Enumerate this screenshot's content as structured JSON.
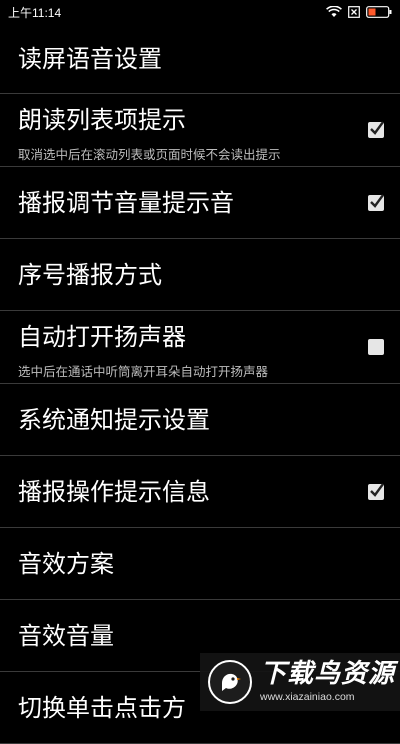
{
  "status_bar": {
    "time": "上午11:14",
    "battery_badge": "✕"
  },
  "header": {
    "title": "读屏语音设置"
  },
  "rows": [
    {
      "title": "朗读列表项提示",
      "summary": "取消选中后在滚动列表或页面时候不会读出提示",
      "checked": true
    },
    {
      "title": "播报调节音量提示音",
      "checked": true
    },
    {
      "title": "序号播报方式"
    },
    {
      "title": "自动打开扬声器",
      "summary": "选中后在通话中听筒离开耳朵自动打开扬声器",
      "checked": false
    },
    {
      "title": "系统通知提示设置"
    },
    {
      "title": "播报操作提示信息",
      "checked": true
    },
    {
      "title": "音效方案"
    },
    {
      "title": "音效音量"
    },
    {
      "title": "切换单击点击方"
    }
  ],
  "watermark": {
    "title": "下载鸟资源",
    "url": "www.xiazainiao.com"
  },
  "colors": {
    "background": "#000000",
    "divider": "#3a3a3a",
    "summary_text": "#bdbdbd"
  }
}
